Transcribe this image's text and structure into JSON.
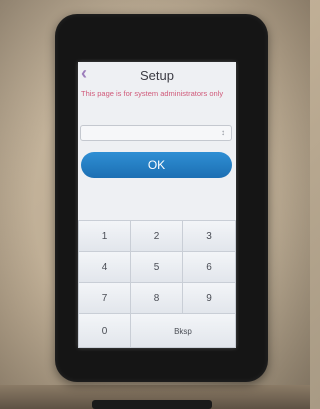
{
  "screen": {
    "title": "Setup",
    "back_icon": "chevron-left-icon",
    "notice": "This page is for system administrators only",
    "input": {
      "value": "",
      "caret_glyph": "↕"
    },
    "ok_label": "OK",
    "keypad": {
      "keys": [
        "1",
        "2",
        "3",
        "4",
        "5",
        "6",
        "7",
        "8",
        "9",
        "0",
        "Bksp"
      ]
    }
  },
  "colors": {
    "accent_blue": "#1c6fb3",
    "notice_pink": "#d05a7a",
    "back_purple": "#9c7dbb"
  }
}
